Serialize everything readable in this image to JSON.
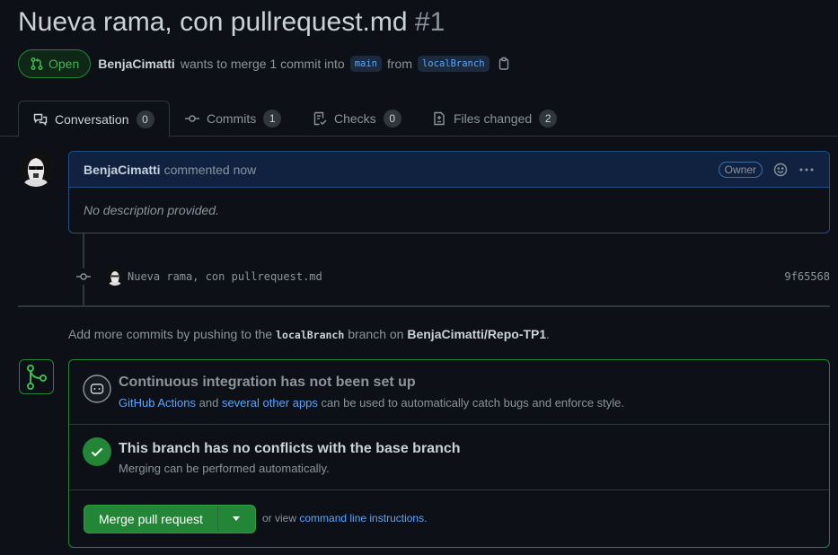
{
  "pr": {
    "title": "Nueva rama, con pullrequest.md",
    "number": "#1",
    "state": "Open",
    "author": "BenjaCimatti",
    "merge_text": "wants to merge 1 commit into",
    "base_branch": "main",
    "from_text": "from",
    "head_branch": "localBranch"
  },
  "tabs": [
    {
      "label": "Conversation",
      "count": "0"
    },
    {
      "label": "Commits",
      "count": "1"
    },
    {
      "label": "Checks",
      "count": "0"
    },
    {
      "label": "Files changed",
      "count": "2"
    }
  ],
  "comment": {
    "author": "BenjaCimatti",
    "time": "commented now",
    "role": "Owner",
    "body": "No description provided."
  },
  "commit": {
    "message": "Nueva rama, con pullrequest.md",
    "sha": "9f65568"
  },
  "push_hint": {
    "prefix": "Add more commits by pushing to the",
    "branch": "localBranch",
    "middle": "branch on",
    "repo": "BenjaCimatti/Repo-TP1",
    "suffix": "."
  },
  "ci": {
    "title": "Continuous integration has not been set up",
    "link1": "GitHub Actions",
    "and_text": "and",
    "link2": "several other apps",
    "rest": "can be used to automatically catch bugs and enforce style."
  },
  "conflicts": {
    "title": "This branch has no conflicts with the base branch",
    "subtitle": "Merging can be performed automatically."
  },
  "merge": {
    "button_label": "Merge pull request",
    "or_view": "or view",
    "cli_link": "command line instructions",
    "period": "."
  },
  "colors": {
    "background": "#0d1117",
    "open_green": "#3fb950",
    "merge_button": "#238636",
    "link_blue": "#58a6ff",
    "comment_border": "#1f4f85"
  }
}
